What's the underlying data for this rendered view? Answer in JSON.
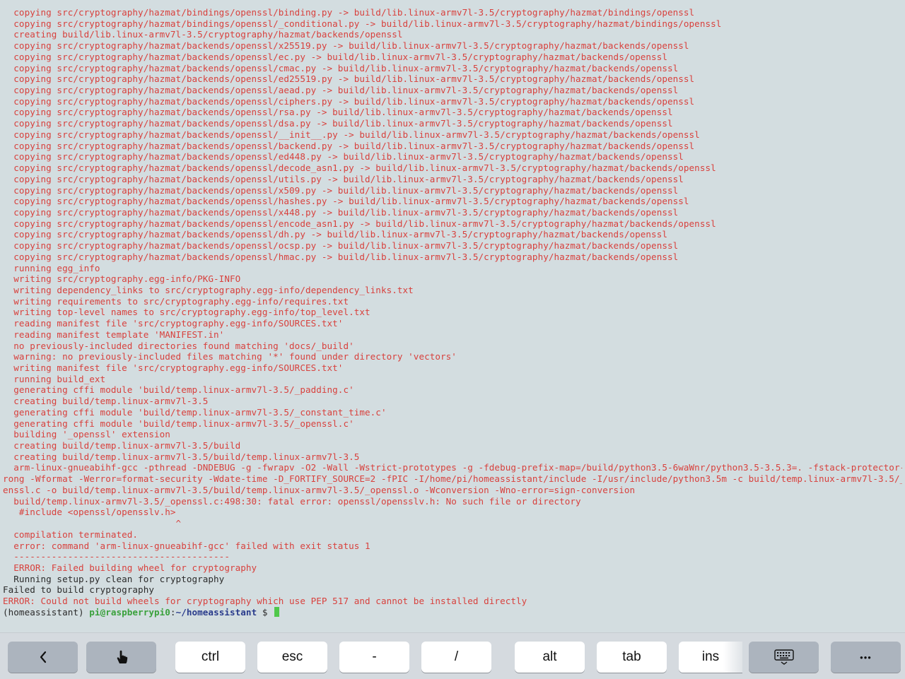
{
  "terminal": {
    "lines": [
      {
        "c": "red",
        "t": "  copying src/cryptography/hazmat/bindings/openssl/binding.py -> build/lib.linux-armv7l-3.5/cryptography/hazmat/bindings/openssl"
      },
      {
        "c": "red",
        "t": "  copying src/cryptography/hazmat/bindings/openssl/_conditional.py -> build/lib.linux-armv7l-3.5/cryptography/hazmat/bindings/openssl"
      },
      {
        "c": "red",
        "t": "  creating build/lib.linux-armv7l-3.5/cryptography/hazmat/backends/openssl"
      },
      {
        "c": "red",
        "t": "  copying src/cryptography/hazmat/backends/openssl/x25519.py -> build/lib.linux-armv7l-3.5/cryptography/hazmat/backends/openssl"
      },
      {
        "c": "red",
        "t": "  copying src/cryptography/hazmat/backends/openssl/ec.py -> build/lib.linux-armv7l-3.5/cryptography/hazmat/backends/openssl"
      },
      {
        "c": "red",
        "t": "  copying src/cryptography/hazmat/backends/openssl/cmac.py -> build/lib.linux-armv7l-3.5/cryptography/hazmat/backends/openssl"
      },
      {
        "c": "red",
        "t": "  copying src/cryptography/hazmat/backends/openssl/ed25519.py -> build/lib.linux-armv7l-3.5/cryptography/hazmat/backends/openssl"
      },
      {
        "c": "red",
        "t": "  copying src/cryptography/hazmat/backends/openssl/aead.py -> build/lib.linux-armv7l-3.5/cryptography/hazmat/backends/openssl"
      },
      {
        "c": "red",
        "t": "  copying src/cryptography/hazmat/backends/openssl/ciphers.py -> build/lib.linux-armv7l-3.5/cryptography/hazmat/backends/openssl"
      },
      {
        "c": "red",
        "t": "  copying src/cryptography/hazmat/backends/openssl/rsa.py -> build/lib.linux-armv7l-3.5/cryptography/hazmat/backends/openssl"
      },
      {
        "c": "red",
        "t": "  copying src/cryptography/hazmat/backends/openssl/dsa.py -> build/lib.linux-armv7l-3.5/cryptography/hazmat/backends/openssl"
      },
      {
        "c": "red",
        "t": "  copying src/cryptography/hazmat/backends/openssl/__init__.py -> build/lib.linux-armv7l-3.5/cryptography/hazmat/backends/openssl"
      },
      {
        "c": "red",
        "t": "  copying src/cryptography/hazmat/backends/openssl/backend.py -> build/lib.linux-armv7l-3.5/cryptography/hazmat/backends/openssl"
      },
      {
        "c": "red",
        "t": "  copying src/cryptography/hazmat/backends/openssl/ed448.py -> build/lib.linux-armv7l-3.5/cryptography/hazmat/backends/openssl"
      },
      {
        "c": "red",
        "t": "  copying src/cryptography/hazmat/backends/openssl/decode_asn1.py -> build/lib.linux-armv7l-3.5/cryptography/hazmat/backends/openssl"
      },
      {
        "c": "red",
        "t": "  copying src/cryptography/hazmat/backends/openssl/utils.py -> build/lib.linux-armv7l-3.5/cryptography/hazmat/backends/openssl"
      },
      {
        "c": "red",
        "t": "  copying src/cryptography/hazmat/backends/openssl/x509.py -> build/lib.linux-armv7l-3.5/cryptography/hazmat/backends/openssl"
      },
      {
        "c": "red",
        "t": "  copying src/cryptography/hazmat/backends/openssl/hashes.py -> build/lib.linux-armv7l-3.5/cryptography/hazmat/backends/openssl"
      },
      {
        "c": "red",
        "t": "  copying src/cryptography/hazmat/backends/openssl/x448.py -> build/lib.linux-armv7l-3.5/cryptography/hazmat/backends/openssl"
      },
      {
        "c": "red",
        "t": "  copying src/cryptography/hazmat/backends/openssl/encode_asn1.py -> build/lib.linux-armv7l-3.5/cryptography/hazmat/backends/openssl"
      },
      {
        "c": "red",
        "t": "  copying src/cryptography/hazmat/backends/openssl/dh.py -> build/lib.linux-armv7l-3.5/cryptography/hazmat/backends/openssl"
      },
      {
        "c": "red",
        "t": "  copying src/cryptography/hazmat/backends/openssl/ocsp.py -> build/lib.linux-armv7l-3.5/cryptography/hazmat/backends/openssl"
      },
      {
        "c": "red",
        "t": "  copying src/cryptography/hazmat/backends/openssl/hmac.py -> build/lib.linux-armv7l-3.5/cryptography/hazmat/backends/openssl"
      },
      {
        "c": "red",
        "t": "  running egg_info"
      },
      {
        "c": "red",
        "t": "  writing src/cryptography.egg-info/PKG-INFO"
      },
      {
        "c": "red",
        "t": "  writing dependency_links to src/cryptography.egg-info/dependency_links.txt"
      },
      {
        "c": "red",
        "t": "  writing requirements to src/cryptography.egg-info/requires.txt"
      },
      {
        "c": "red",
        "t": "  writing top-level names to src/cryptography.egg-info/top_level.txt"
      },
      {
        "c": "red",
        "t": "  reading manifest file 'src/cryptography.egg-info/SOURCES.txt'"
      },
      {
        "c": "red",
        "t": "  reading manifest template 'MANIFEST.in'"
      },
      {
        "c": "red",
        "t": "  no previously-included directories found matching 'docs/_build'"
      },
      {
        "c": "red",
        "t": "  warning: no previously-included files matching '*' found under directory 'vectors'"
      },
      {
        "c": "red",
        "t": "  writing manifest file 'src/cryptography.egg-info/SOURCES.txt'"
      },
      {
        "c": "red",
        "t": "  running build_ext"
      },
      {
        "c": "red",
        "t": "  generating cffi module 'build/temp.linux-armv7l-3.5/_padding.c'"
      },
      {
        "c": "red",
        "t": "  creating build/temp.linux-armv7l-3.5"
      },
      {
        "c": "red",
        "t": "  generating cffi module 'build/temp.linux-armv7l-3.5/_constant_time.c'"
      },
      {
        "c": "red",
        "t": "  generating cffi module 'build/temp.linux-armv7l-3.5/_openssl.c'"
      },
      {
        "c": "red",
        "t": "  building '_openssl' extension"
      },
      {
        "c": "red",
        "t": "  creating build/temp.linux-armv7l-3.5/build"
      },
      {
        "c": "red",
        "t": "  creating build/temp.linux-armv7l-3.5/build/temp.linux-armv7l-3.5"
      },
      {
        "c": "red",
        "t": "  arm-linux-gnueabihf-gcc -pthread -DNDEBUG -g -fwrapv -O2 -Wall -Wstrict-prototypes -g -fdebug-prefix-map=/build/python3.5-6waWnr/python3.5-3.5.3=. -fstack-protector-st"
      },
      {
        "c": "red",
        "t": "rong -Wformat -Werror=format-security -Wdate-time -D_FORTIFY_SOURCE=2 -fPIC -I/home/pi/homeassistant/include -I/usr/include/python3.5m -c build/temp.linux-armv7l-3.5/_op"
      },
      {
        "c": "red",
        "t": "enssl.c -o build/temp.linux-armv7l-3.5/build/temp.linux-armv7l-3.5/_openssl.o -Wconversion -Wno-error=sign-conversion"
      },
      {
        "c": "red",
        "t": "  build/temp.linux-armv7l-3.5/_openssl.c:498:30: fatal error: openssl/opensslv.h: No such file or directory"
      },
      {
        "c": "red",
        "t": "   #include <openssl/opensslv.h>"
      },
      {
        "c": "red",
        "t": "                                ^"
      },
      {
        "c": "red",
        "t": "  compilation terminated."
      },
      {
        "c": "red",
        "t": "  error: command 'arm-linux-gnueabihf-gcc' failed with exit status 1"
      },
      {
        "c": "red",
        "t": "  ----------------------------------------"
      },
      {
        "c": "red",
        "t": "  ERROR: Failed building wheel for cryptography"
      },
      {
        "c": "dark",
        "t": "  Running setup.py clean for cryptography"
      },
      {
        "c": "dark",
        "t": "Failed to build cryptography"
      },
      {
        "c": "red",
        "t": "ERROR: Could not build wheels for cryptography which use PEP 517 and cannot be installed directly"
      }
    ],
    "prompt": {
      "env": "(homeassistant) ",
      "user_host": "pi@raspberrypi0",
      "sep": ":",
      "path": "~/homeassistant",
      "symbol": " $ "
    }
  },
  "toolbar": {
    "back_icon": "chevron-left-icon",
    "touch_icon": "hand-pointer-icon",
    "ctrl": "ctrl",
    "esc": "esc",
    "dash": "-",
    "slash": "/",
    "alt": "alt",
    "tab": "tab",
    "ins": "ins",
    "keyboard_icon": "keyboard-hide-icon",
    "more": "•••"
  },
  "colors": {
    "background": "#d3dde0",
    "error_text": "#d8413d",
    "normal_text": "#2b2b2b",
    "prompt_user": "#3aa13c",
    "prompt_path": "#2a3c8c",
    "cursor": "#4fc84a"
  }
}
